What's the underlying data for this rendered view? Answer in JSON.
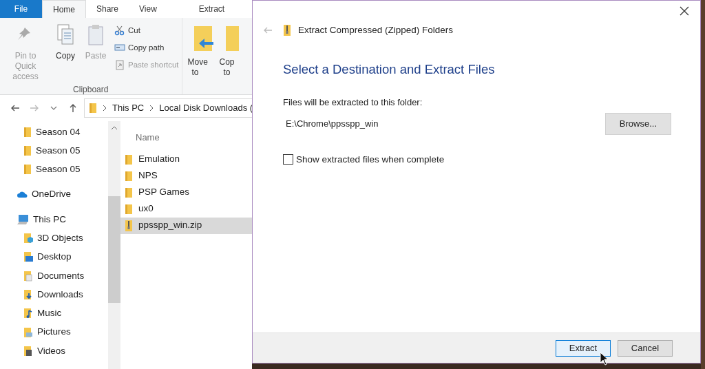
{
  "explorer": {
    "ribbon_tabs": [
      {
        "label": "File",
        "kind": "file",
        "selected": false
      },
      {
        "label": "Home",
        "kind": "tab",
        "selected": true
      },
      {
        "label": "Share",
        "kind": "tab",
        "selected": false
      },
      {
        "label": "View",
        "kind": "tab",
        "selected": false
      },
      {
        "label": "Extract",
        "kind": "context",
        "selected": false
      }
    ],
    "ribbon": {
      "clipboard": {
        "label": "Clipboard",
        "large": [
          {
            "label": "Pin to Quick access",
            "kind": "pin",
            "disabled": true
          },
          {
            "label": "Copy",
            "kind": "copy",
            "disabled": false
          },
          {
            "label": "Paste",
            "kind": "paste",
            "disabled": true
          }
        ],
        "small": [
          {
            "label": "Cut",
            "kind": "cut",
            "disabled": false
          },
          {
            "label": "Copy path",
            "kind": "path",
            "disabled": false
          },
          {
            "label": "Paste shortcut",
            "kind": "shortcut",
            "disabled": true
          }
        ]
      },
      "organize": [
        {
          "label": "Move",
          "sub": "to",
          "kind": "move"
        },
        {
          "label": "Cop",
          "sub": "to",
          "kind": "copyto"
        }
      ]
    },
    "address": {
      "crumbs": [
        "This PC",
        "Local Disk Downloads ("
      ]
    },
    "nav": [
      {
        "label": "Season 04",
        "kind": "folder"
      },
      {
        "label": "Season 05",
        "kind": "folder"
      },
      {
        "label": "Season 05",
        "kind": "folder"
      },
      {
        "label": "OneDrive",
        "kind": "onedrive"
      },
      {
        "label": "This PC",
        "kind": "pc",
        "children": [
          {
            "label": "3D Objects",
            "kind": "objects"
          },
          {
            "label": "Desktop",
            "kind": "desktop"
          },
          {
            "label": "Documents",
            "kind": "documents"
          },
          {
            "label": "Downloads",
            "kind": "downloads"
          },
          {
            "label": "Music",
            "kind": "music"
          },
          {
            "label": "Pictures",
            "kind": "pictures"
          },
          {
            "label": "Videos",
            "kind": "videos"
          }
        ]
      }
    ],
    "files": {
      "column": "Name",
      "items": [
        {
          "label": "Emulation",
          "kind": "folder",
          "selected": false
        },
        {
          "label": "NPS",
          "kind": "folder",
          "selected": false
        },
        {
          "label": "PSP Games",
          "kind": "folder",
          "selected": false
        },
        {
          "label": "ux0",
          "kind": "folder",
          "selected": false
        },
        {
          "label": "ppsspp_win.zip",
          "kind": "zip",
          "selected": true
        }
      ]
    }
  },
  "dialog": {
    "title": "Extract Compressed (Zipped) Folders",
    "heading": "Select a Destination and Extract Files",
    "path_label": "Files will be extracted to this folder:",
    "path": "E:\\Chrome\\ppsspp_win",
    "browse": "Browse...",
    "show_files": {
      "label": "Show extracted files when complete",
      "checked": false
    },
    "buttons": [
      {
        "label": "Extract",
        "default": true
      },
      {
        "label": "Cancel",
        "default": false
      }
    ]
  }
}
